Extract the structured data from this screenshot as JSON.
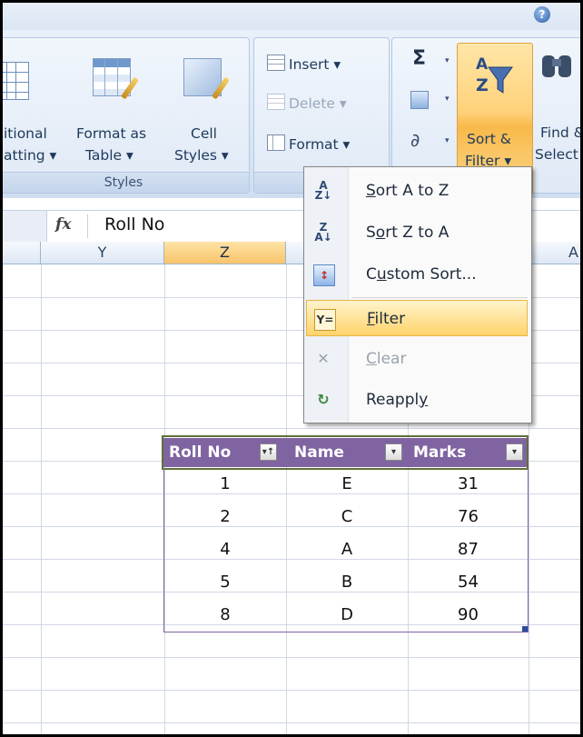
{
  "ribbon": {
    "styles_group": {
      "label": "Styles",
      "conditional_line1": "itional",
      "conditional_line2": "atting ▾",
      "format_table_line1": "Format as",
      "format_table_line2": "Table ▾",
      "cell_styles_line1": "Cell",
      "cell_styles_line2": "Styles ▾"
    },
    "cells_group": {
      "insert": "Insert ▾",
      "delete": "Delete ▾",
      "format": "Format ▾"
    },
    "editing_group": {
      "sigma": "Σ",
      "sort_filter_line1": "Sort &",
      "sort_filter_line2": "Filter ▾",
      "find_line1": "Find &",
      "find_line2": "Select"
    }
  },
  "formula_bar": {
    "fx": "fx",
    "value": "Roll No"
  },
  "columns": [
    "Y",
    "Z",
    "A"
  ],
  "table": {
    "headers": [
      "Roll No",
      "Name",
      "Marks"
    ],
    "rows": [
      [
        "1",
        "E",
        "31"
      ],
      [
        "2",
        "C",
        "76"
      ],
      [
        "4",
        "A",
        "87"
      ],
      [
        "5",
        "B",
        "54"
      ],
      [
        "8",
        "D",
        "90"
      ]
    ]
  },
  "menu": {
    "items": [
      {
        "pre": "",
        "mn": "S",
        "post": "ort A to Z"
      },
      {
        "pre": "S",
        "mn": "o",
        "post": "rt Z to A"
      },
      {
        "pre": "C",
        "mn": "u",
        "post": "stom Sort..."
      },
      {
        "pre": "",
        "mn": "F",
        "post": "ilter"
      },
      {
        "pre": "",
        "mn": "C",
        "post": "lear"
      },
      {
        "pre": "Reappl",
        "mn": "y",
        "post": ""
      }
    ]
  },
  "colors": {
    "accent_table": "#8064a2",
    "menu_highlight": "#ffd36b",
    "active_column": "#f9c46a"
  }
}
